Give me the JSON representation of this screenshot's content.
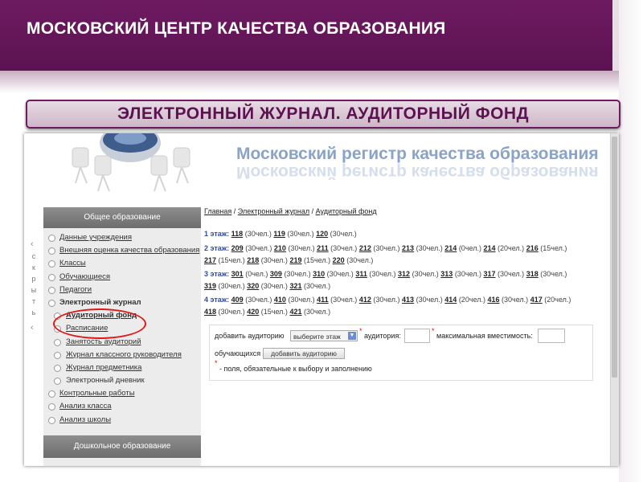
{
  "slide": {
    "title": "МОСКОВСКИЙ ЦЕНТР КАЧЕСТВА ОБРАЗОВАНИЯ",
    "section_title": "ЭЛЕКТРОННЫЙ ЖУРНАЛ. АУДИТОРНЫЙ ФОНД"
  },
  "colors": {
    "brand": "#6e1b62",
    "registry": "#8aa3c8",
    "floor_label": "#2a4ea8",
    "highlight_oval": "#e01818"
  },
  "site": {
    "title": "Московский регистр качества образования",
    "side_collapse_letters": [
      "с",
      "к",
      "р",
      "ы",
      "т",
      "ь"
    ],
    "breadcrumb": [
      "Главная",
      "Электронный журнал",
      "Аудиторный фонд"
    ],
    "sidebar": {
      "header": "Общее образование",
      "items": [
        {
          "label": "Данные учреждения",
          "level": 0,
          "link": true
        },
        {
          "label": "Внешняя оценка качества образования",
          "level": 0,
          "link": true
        },
        {
          "label": "Классы",
          "level": 0,
          "link": true
        },
        {
          "label": "Обучающиеся",
          "level": 0,
          "link": true
        },
        {
          "label": "Педагоги",
          "level": 0,
          "link": true
        },
        {
          "label": "Электронный журнал",
          "level": 0,
          "link": false,
          "bold": true
        },
        {
          "label": "Аудиторный фонд",
          "level": 1,
          "link": true,
          "bold": true
        },
        {
          "label": "Расписание",
          "level": 1,
          "link": true
        },
        {
          "label": "Занятость аудиторий",
          "level": 1,
          "link": true
        },
        {
          "label": "Журнал классного руководителя",
          "level": 1,
          "link": true
        },
        {
          "label": "Журнал предметника",
          "level": 1,
          "link": true
        },
        {
          "label": "Электронный дневник",
          "level": 1,
          "link": false
        },
        {
          "label": "Контрольные работы",
          "level": 0,
          "link": true
        },
        {
          "label": "Анализ класса",
          "level": 0,
          "link": true
        },
        {
          "label": "Анализ школы",
          "level": 0,
          "link": true
        }
      ],
      "header2": "Дошкольное образование"
    },
    "floors": [
      {
        "label": "1 этаж:",
        "rooms": [
          [
            "118",
            "(30чел.)"
          ],
          [
            "119",
            "(30чел.)"
          ],
          [
            "120",
            "(30чел.)"
          ]
        ]
      },
      {
        "label": "2 этаж:",
        "rooms": [
          [
            "209",
            "(30чел.)"
          ],
          [
            "210",
            "(30чел.)"
          ],
          [
            "211",
            "(30чел.)"
          ],
          [
            "212",
            "(30чел.)"
          ],
          [
            "213",
            "(30чел.)"
          ],
          [
            "214",
            "(0чел.)"
          ],
          [
            "214",
            "(20чел.)"
          ],
          [
            "216",
            "(15чел.)"
          ],
          [
            "217",
            "(15чел.)"
          ],
          [
            "218",
            "(30чел.)"
          ],
          [
            "219",
            "(15чел.)"
          ],
          [
            "220",
            "(30чел.)"
          ]
        ]
      },
      {
        "label": "3 этаж:",
        "rooms": [
          [
            "301",
            "(0чел.)"
          ],
          [
            "309",
            "(30чел.)"
          ],
          [
            "310",
            "(30чел.)"
          ],
          [
            "311",
            "(30чел.)"
          ],
          [
            "312",
            "(30чел.)"
          ],
          [
            "313",
            "(30чел.)"
          ],
          [
            "317",
            "(30чел.)"
          ],
          [
            "318",
            "(30чел.)"
          ],
          [
            "319",
            "(30чел.)"
          ],
          [
            "320",
            "(30чел.)"
          ],
          [
            "321",
            "(30чел.)"
          ]
        ]
      },
      {
        "label": "4 этаж:",
        "rooms": [
          [
            "409",
            "(30чел.)"
          ],
          [
            "410",
            "(30чел.)"
          ],
          [
            "411",
            "(30чел.)"
          ],
          [
            "412",
            "(30чел.)"
          ],
          [
            "413",
            "(30чел.)"
          ],
          [
            "414",
            "(20чел.)"
          ],
          [
            "416",
            "(30чел.)"
          ],
          [
            "417",
            "(20чел.)"
          ],
          [
            "418",
            "(30чел.)"
          ],
          [
            "420",
            "(15чел.)"
          ],
          [
            "421",
            "(30чел.)"
          ]
        ]
      }
    ],
    "form": {
      "add_label": "добавить аудиторию",
      "floor_select": "выберите этаж",
      "room_label": "аудитория:",
      "capacity_label": "максимальная вместимость:",
      "students_label": "обучающихся",
      "add_button": "добавить аудиторию",
      "required_mark": "*",
      "required_note": "- поля, обязательные к выбору и заполнению"
    }
  }
}
